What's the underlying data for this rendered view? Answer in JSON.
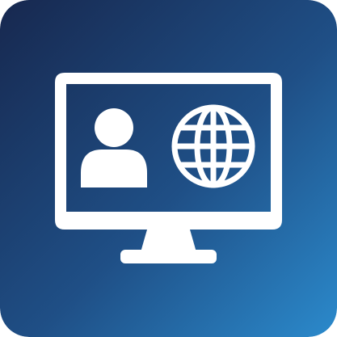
{
  "icon": {
    "subject": "monitor-with-user-and-globe",
    "colors": {
      "gradient_start": "#17284f",
      "gradient_mid": "#1f4f86",
      "gradient_end": "#2b8acc",
      "glyph": "#ffffff"
    }
  }
}
